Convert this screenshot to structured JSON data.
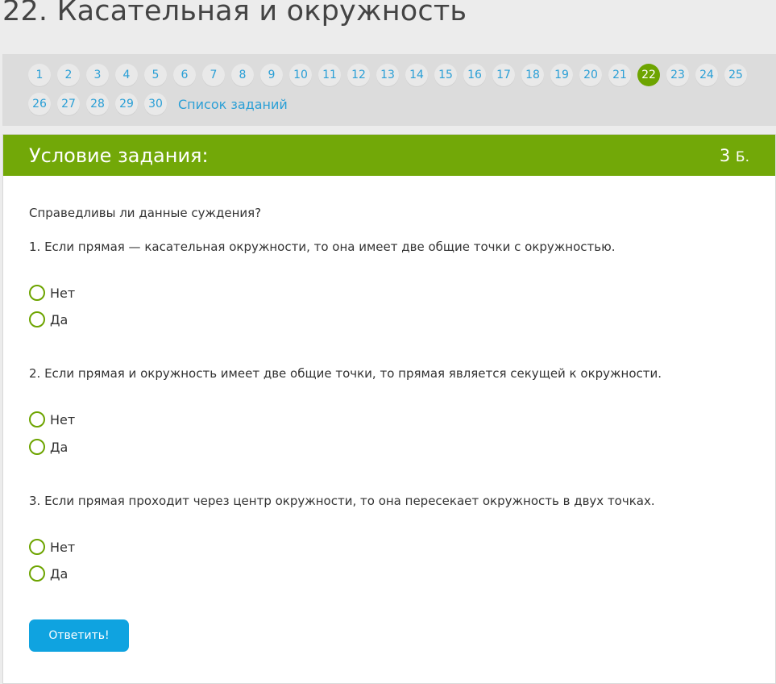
{
  "page": {
    "title": "22. Касательная и окружность"
  },
  "pager": {
    "row1": [
      "1",
      "2",
      "3",
      "4",
      "5",
      "6",
      "7",
      "8",
      "9",
      "10",
      "11",
      "12",
      "13",
      "14",
      "15",
      "16",
      "17",
      "18",
      "19",
      "20",
      "21",
      "22",
      "23",
      "24",
      "25"
    ],
    "row2": [
      "26",
      "27",
      "28",
      "29",
      "30"
    ],
    "active": "22",
    "tasks_link": "Список заданий"
  },
  "task": {
    "header_title": "Условие задания:",
    "score_value": "3",
    "score_unit": "Б.",
    "intro": "Справедливы ли данные суждения?",
    "questions": [
      {
        "text": "1. Если прямая — касательная окружности, то она имеет две общие точки с окружностью.",
        "options": [
          "Нет",
          "Да"
        ]
      },
      {
        "text": "2. Если прямая и окружность имеет две общие точки, то прямая является секущей к окружности.",
        "options": [
          "Нет",
          "Да"
        ]
      },
      {
        "text": "3. Если прямая проходит через центр окружности, то она пересекает окружность в двух точках.",
        "options": [
          "Нет",
          "Да"
        ]
      }
    ],
    "submit_label": "Ответить!"
  },
  "colors": {
    "accent_green": "#72a808",
    "link_blue": "#2a9fd6",
    "button_blue": "#0fa3e0"
  }
}
